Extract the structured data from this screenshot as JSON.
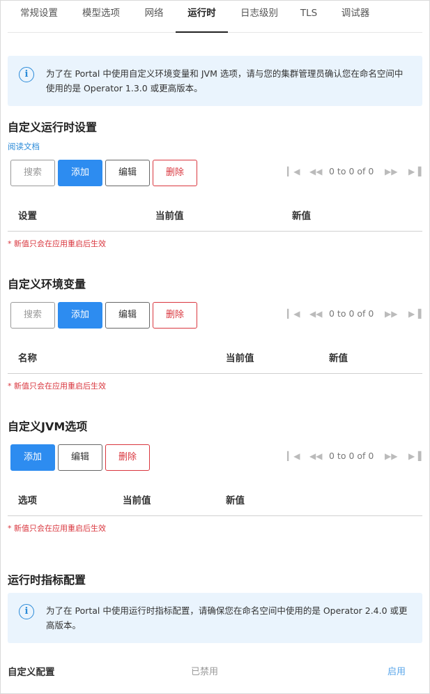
{
  "tabs": [
    {
      "label": "常规设置"
    },
    {
      "label": "模型选项"
    },
    {
      "label": "网络"
    },
    {
      "label": "运行时"
    },
    {
      "label": "日志级别"
    },
    {
      "label": "TLS"
    },
    {
      "label": "调试器"
    }
  ],
  "banner1": {
    "text": "为了在 Portal 中使用自定义环境变量和 JVM 选项，请与您的集群管理员确认您在命名空间中使用的是 Operator 1.3.0 或更高版本。"
  },
  "runtime": {
    "title": "自定义运行时设置",
    "docs_link": "阅读文档",
    "search_label": "搜索",
    "add_label": "添加",
    "edit_label": "编辑",
    "delete_label": "删除",
    "pager_text": "0 to 0 of 0",
    "columns": [
      "设置",
      "当前值",
      "新值"
    ],
    "note": "* 新值只会在应用重启后生效"
  },
  "env": {
    "title": "自定义环境变量",
    "search_label": "搜索",
    "add_label": "添加",
    "edit_label": "编辑",
    "delete_label": "删除",
    "pager_text": "0 to 0 of 0",
    "columns": [
      "名称",
      "当前值",
      "新值"
    ],
    "note": "* 新值只会在应用重启后生效"
  },
  "jvm": {
    "title": "自定义JVM选项",
    "add_label": "添加",
    "edit_label": "编辑",
    "delete_label": "删除",
    "pager_text": "0 to 0 of 0",
    "columns": [
      "选项",
      "当前值",
      "新值"
    ],
    "note": "* 新值只会在应用重启后生效"
  },
  "metrics": {
    "title": "运行时指标配置",
    "banner_text": "为了在 Portal 中使用运行时指标配置，请确保您在命名空间中使用的是 Operator 2.4.0 或更高版本。",
    "custom_label": "自定义配置",
    "status": "已禁用",
    "enable_label": "启用"
  },
  "colors": {
    "accent": "#2d8cf0",
    "danger": "#d9363e",
    "banner_bg": "#eaf4fd"
  },
  "icons": [
    "info-icon",
    "first-page-icon",
    "prev-page-icon",
    "next-page-icon",
    "last-page-icon"
  ]
}
